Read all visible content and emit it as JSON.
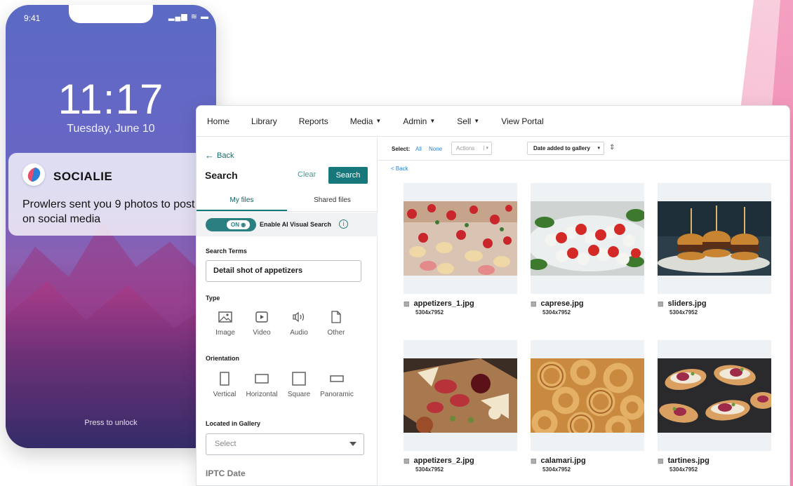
{
  "phone": {
    "status_time": "9:41",
    "status_icons": "▂▄▆ ≋ ▬",
    "clock": "11:17",
    "date": "Tuesday, June 10",
    "notification": {
      "app_name": "SOCIALIE",
      "message": "Prowlers sent you 9 photos to post on social media"
    },
    "unlock_text": "Press to unlock"
  },
  "app": {
    "nav": [
      {
        "label": "Home",
        "caret": false
      },
      {
        "label": "Library",
        "caret": false
      },
      {
        "label": "Reports",
        "caret": false
      },
      {
        "label": "Media",
        "caret": true
      },
      {
        "label": "Admin",
        "caret": true
      },
      {
        "label": "Sell",
        "caret": true
      },
      {
        "label": "View Portal",
        "caret": false
      }
    ],
    "left": {
      "back_label": "Back",
      "search_title": "Search",
      "clear_label": "Clear",
      "search_button": "Search",
      "tabs": [
        "My files",
        "Shared files"
      ],
      "toggle_label": "ON",
      "ai_label": "Enable AI Visual Search",
      "search_terms_label": "Search Terms",
      "search_terms_value": "Detail shot of appetizers",
      "type_label": "Type",
      "types": [
        "Image",
        "Video",
        "Audio",
        "Other"
      ],
      "orientation_label": "Orientation",
      "orientations": [
        "Vertical",
        "Horizontal",
        "Square",
        "Panoramic"
      ],
      "gallery_label": "Located in Gallery",
      "gallery_placeholder": "Select",
      "iptc_label": "IPTC Date"
    },
    "right": {
      "select_label": "Select:",
      "select_all": "All",
      "select_none": "None",
      "actions_label": "Actions",
      "sort_label": "Date added to gallery",
      "back_label": "< Back",
      "files": [
        {
          "name": "appetizers_1.jpg",
          "dims": "5304x7952"
        },
        {
          "name": "caprese.jpg",
          "dims": "5304x7952"
        },
        {
          "name": "sliders.jpg",
          "dims": "5304x7952"
        },
        {
          "name": "appetizers_2.jpg",
          "dims": "5304x7952"
        },
        {
          "name": "calamari.jpg",
          "dims": "5304x7952"
        },
        {
          "name": "tartines.jpg",
          "dims": "5304x7952"
        }
      ]
    }
  },
  "colors": {
    "accent": "#16787a",
    "link": "#2a7fd6",
    "brand_red": "#e94b6b",
    "brand_blue": "#2b7fd6"
  }
}
